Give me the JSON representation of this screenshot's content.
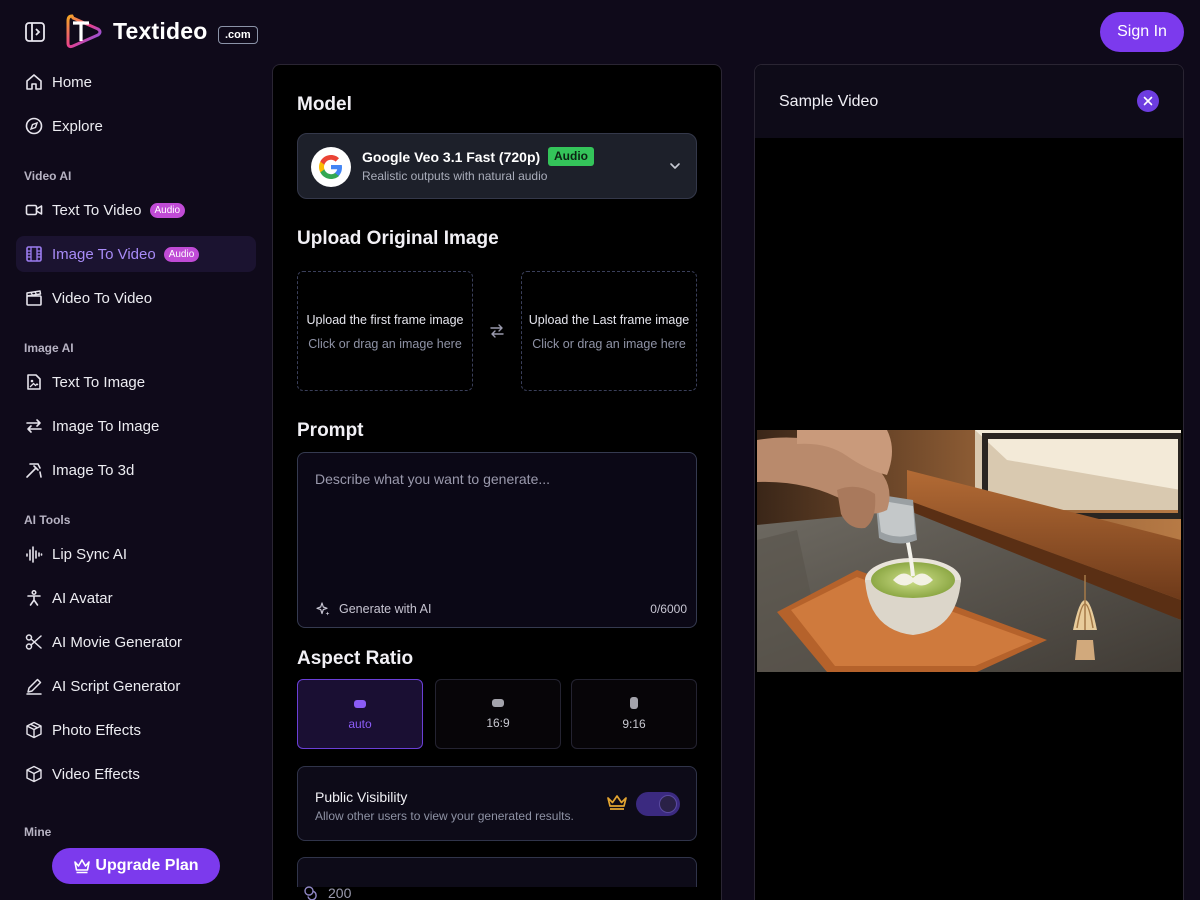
{
  "app": {
    "brand": "Textideo",
    "tld": ".com"
  },
  "header": {
    "signin_label": "Sign In"
  },
  "sidebar": {
    "home": "Home",
    "explore": "Explore",
    "sections": {
      "video_ai": "Video AI",
      "image_ai": "Image AI",
      "ai_tools": "AI Tools",
      "mine": "Mine"
    },
    "video_ai": [
      {
        "label": "Text To Video",
        "badge": "Audio",
        "icon": "video-camera-icon"
      },
      {
        "label": "Image To Video",
        "badge": "Audio",
        "icon": "film-icon",
        "active": true
      },
      {
        "label": "Video To Video",
        "icon": "clapperboard-icon"
      }
    ],
    "image_ai": [
      {
        "label": "Text To Image",
        "icon": "image-file-icon"
      },
      {
        "label": "Image To Image",
        "icon": "swap-arrows-icon"
      },
      {
        "label": "Image To 3d",
        "icon": "wand-icon"
      }
    ],
    "ai_tools": [
      {
        "label": "Lip Sync AI",
        "icon": "audio-wave-icon"
      },
      {
        "label": "AI Avatar",
        "icon": "person-icon"
      },
      {
        "label": "AI Movie Generator",
        "icon": "scissors-icon"
      },
      {
        "label": "AI Script Generator",
        "icon": "pen-icon"
      },
      {
        "label": "Photo Effects",
        "icon": "box-icon"
      },
      {
        "label": "Video Effects",
        "icon": "box-icon"
      }
    ],
    "upgrade_label": "Upgrade Plan"
  },
  "form": {
    "model_heading": "Model",
    "model": {
      "name": "Google Veo 3.1 Fast (720p)",
      "badge": "Audio",
      "description": "Realistic outputs with natural audio"
    },
    "upload_heading": "Upload Original Image",
    "upload_first": {
      "title": "Upload the first frame image",
      "hint": "Click or drag an image here"
    },
    "upload_last": {
      "title": "Upload the Last frame image",
      "hint": "Click or drag an image here"
    },
    "prompt_heading": "Prompt",
    "prompt_placeholder": "Describe what you want to generate...",
    "prompt_value": "",
    "generate_ai_label": "Generate with AI",
    "char_counter": "0/6000",
    "aspect_heading": "Aspect Ratio",
    "aspect_options": [
      {
        "label": "auto",
        "selected": true
      },
      {
        "label": "16:9",
        "selected": false
      },
      {
        "label": "9:16",
        "selected": false
      }
    ],
    "visibility": {
      "title": "Public Visibility",
      "description": "Allow other users to view your generated results.",
      "enabled": true
    },
    "credits": "200"
  },
  "preview": {
    "title": "Sample Video"
  },
  "colors": {
    "accent": "#7c3aed",
    "audio_pill": "#c04bd6",
    "audio_badge": "#34c45a",
    "background": "#0f0a1a"
  }
}
